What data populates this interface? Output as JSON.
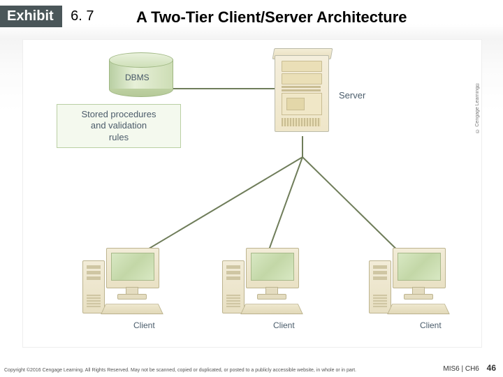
{
  "header": {
    "exhibit_word": "Exhibit",
    "exhibit_number": "6. 7",
    "title": "A Two-Tier Client/Server Architecture"
  },
  "diagram": {
    "dbms_label": "DBMS",
    "stored_proc_label": "Stored procedures\nand validation\nrules",
    "server_label": "Server",
    "clients": [
      "Client",
      "Client",
      "Client"
    ]
  },
  "footer": {
    "copyright": "Copyright ©2016 Cengage Learning. All Rights Reserved. May not be scanned, copied or duplicated, or posted to a publicly accessible website, in whole or in part.",
    "side_copyright": "© Cengage Learning®",
    "book_ref": "MIS6 | CH6",
    "page_number": "46"
  }
}
